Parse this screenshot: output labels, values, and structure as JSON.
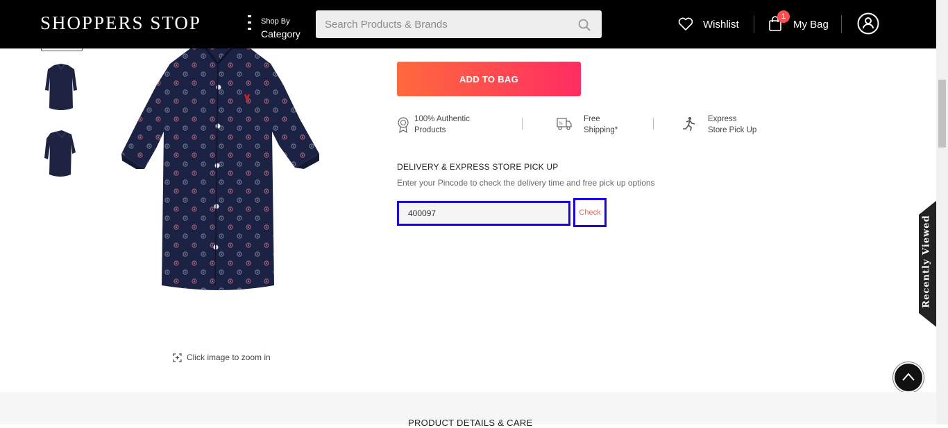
{
  "header": {
    "logo_main": "SHOPPERS STOP",
    "shop_by_line1": "Shop By",
    "shop_by_line2": "Category",
    "search_placeholder": "Search Products & Brands",
    "wishlist_label": "Wishlist",
    "bag_label": "My Bag",
    "bag_count": "1"
  },
  "product": {
    "zoom_hint": "Click image to zoom in"
  },
  "actions": {
    "add_to_bag": "ADD TO BAG"
  },
  "features": [
    {
      "line1": "100% Authentic",
      "line2": "Products",
      "icon": "award-badge-icon"
    },
    {
      "line1": "Free",
      "line2": "Shipping*",
      "icon": "delivery-truck-icon"
    },
    {
      "line1": "Express",
      "line2": "Store Pick Up",
      "icon": "running-person-icon"
    }
  ],
  "delivery": {
    "title": "DELIVERY & EXPRESS STORE PICK UP",
    "subtitle": "Enter your Pincode to check the delivery time and free pick up options",
    "pincode_value": "400097",
    "check_label": "Check"
  },
  "sidebar_tab": {
    "label": "Recently Viewed"
  },
  "section": {
    "details_title": "PRODUCT DETAILS & CARE"
  },
  "colors": {
    "header_bg": "#000000",
    "accent_start": "#ff6a3d",
    "accent_end": "#ff2d62",
    "check_text": "#ff5a3c",
    "focus_outline": "#1a00e6"
  }
}
